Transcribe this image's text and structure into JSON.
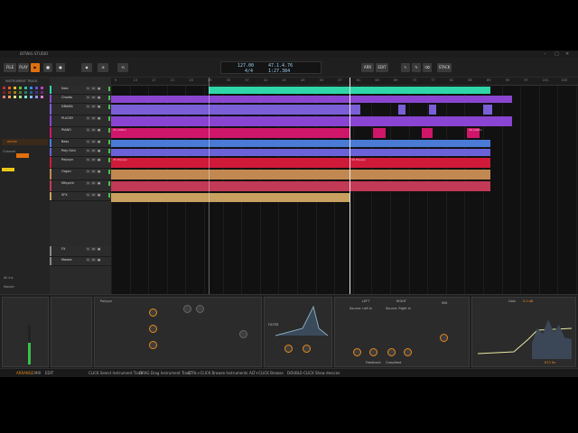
{
  "window": {
    "title": "BITWIG STUDIO"
  },
  "toolbar": {
    "file": "FILE",
    "play": "PLAY",
    "tempo": "127.00",
    "signature": "4/4",
    "position": "47.1.4.76",
    "time": "1:27.384",
    "arrange_btn": "ARR",
    "edit_btn": "EDIT",
    "stack_btn": "STACK"
  },
  "inspector": {
    "header": "INSTRUMENT TRACK",
    "active": "Active",
    "channel": "Channel",
    "all_ins": "All ins",
    "master": "Master"
  },
  "tracks": [
    {
      "name": "Solo",
      "color": "#2fd6a8"
    },
    {
      "name": "Chords",
      "color": "#8a46d0"
    },
    {
      "name": "DRAMA",
      "color": "#7a5fd6"
    },
    {
      "name": "PLUCKY",
      "color": "#8a44d2"
    },
    {
      "name": "PIANO",
      "color": "#d0166a"
    },
    {
      "name": "Bass",
      "color": "#4a7ad6"
    },
    {
      "name": "Poly Grid",
      "color": "#6a62d6"
    },
    {
      "name": "Polysyn",
      "color": "#d01a3a"
    },
    {
      "name": "Organ",
      "color": "#c28852"
    },
    {
      "name": "Mfsynth",
      "color": "#c23a56"
    },
    {
      "name": "SFX",
      "color": "#c8a060"
    },
    {
      "name": "FX",
      "color": "#888888"
    },
    {
      "name": "Master",
      "color": "#888888"
    }
  ],
  "ruler": {
    "bars": [
      "9",
      "13",
      "17",
      "21",
      "25",
      "29",
      "33",
      "37",
      "41",
      "45",
      "49",
      "53",
      "57",
      "61",
      "65",
      "69",
      "73",
      "77",
      "81",
      "85",
      "89",
      "93",
      "97",
      "101",
      "105"
    ]
  },
  "clip_labels": {
    "a": "25 AUDIO",
    "b": "49 AUDIO",
    "c": "25 Polysyn",
    "d": "49 Polysyn"
  },
  "devices": {
    "polymer": "Polysyn",
    "filter": "FILTER",
    "delay_left": "LEFT",
    "delay_right": "RIGHT",
    "source_left": "Source: Left In",
    "source_right": "Source: Right In",
    "mix": "MIX",
    "feedback": "Feedback",
    "crossfeed": "Crossfeed",
    "eq_label": "Gain",
    "freq": "870 Hz",
    "gain_val": "0.0 dB"
  },
  "status": {
    "items": [
      "ARRANGE",
      "MIX",
      "EDIT",
      "CLICK  Select Instrument Track",
      "DRAG  Drag Instrument Track",
      "CTRL+CLICK  Browse Instruments",
      "ALT+CLICK  Browse",
      "DOUBLE-CLICK  Show devices"
    ]
  }
}
